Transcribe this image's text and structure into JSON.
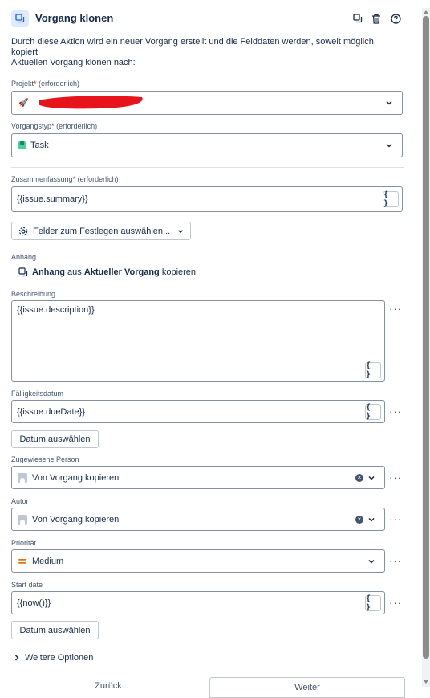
{
  "header": {
    "title": "Vorgang klonen",
    "description": "Durch diese Aktion wird ein neuer Vorgang erstellt und die Felddaten werden, soweit möglich, kopiert.",
    "subtitle": "Aktuellen Vorgang klonen nach:"
  },
  "projekt": {
    "label": "Projekt",
    "required_marker": "*",
    "hint": "(erforderlich)"
  },
  "vorgangstyp": {
    "label": "Vorgangstyp",
    "required_marker": "*",
    "hint": "(erforderlich)",
    "value": "Task"
  },
  "zusammenfassung": {
    "label": "Zusammenfassung",
    "required_marker": "*",
    "hint": "(erforderlich)",
    "value": "{{issue.summary}}"
  },
  "felder_button": {
    "label": "Felder zum Festlegen auswählen..."
  },
  "anhang": {
    "label": "Anhang",
    "text_bold_1": "Anhang",
    "text_mid": "aus",
    "text_bold_2": "Aktueller Vorgang",
    "text_end": "kopieren"
  },
  "beschreibung": {
    "label": "Beschreibung",
    "value": "{{issue.description}}"
  },
  "faelligkeitsdatum": {
    "label": "Fälligkeitsdatum",
    "value": "{{issue.dueDate}}",
    "date_button": "Datum auswählen"
  },
  "zugewiesene_person": {
    "label": "Zugewiesene Person",
    "value": "Von Vorgang kopieren"
  },
  "autor": {
    "label": "Autor",
    "value": "Von Vorgang kopieren"
  },
  "prioritaet": {
    "label": "Priorität",
    "value": "Medium",
    "color": "#e2740d"
  },
  "start_date": {
    "label": "Start date",
    "value": "{{now()}}",
    "date_button": "Datum auswählen"
  },
  "weitere_optionen": {
    "label": "Weitere Optionen"
  },
  "footer": {
    "back": "Zurück",
    "next": "Weiter"
  },
  "colors": {
    "accent": "#0c66e4",
    "required": "#c9372c",
    "redaction": "#e8141c"
  }
}
